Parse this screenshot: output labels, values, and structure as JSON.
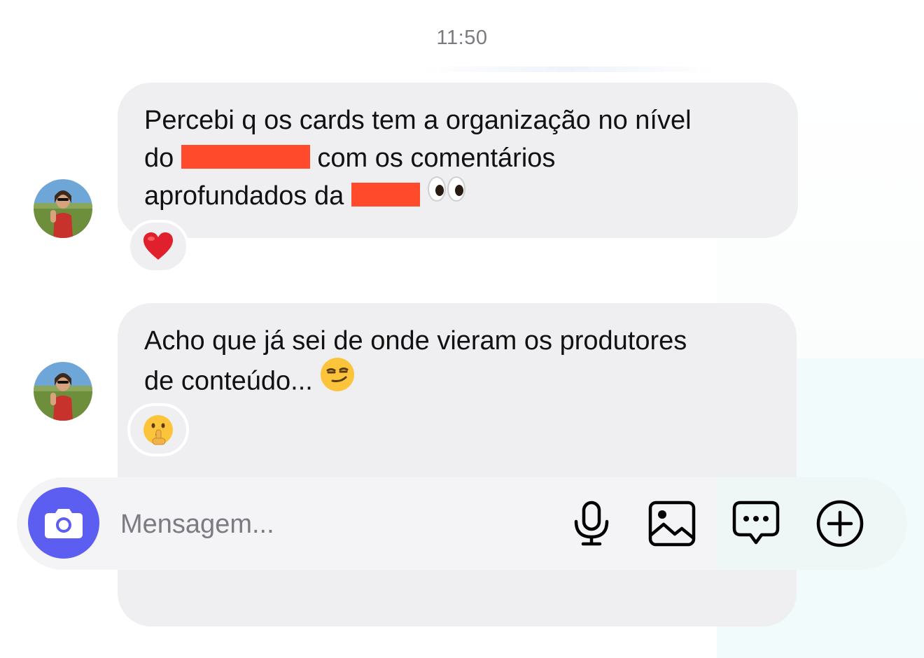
{
  "timestamp": "11:50",
  "messages": [
    {
      "line1": "Percebi q os cards tem a organização no nível",
      "line2_a": "do ",
      "line2_b": " com os comentários",
      "line3_a": "aprofundados da ",
      "line3_emoji": "eyes-emoji",
      "reaction": "heart-emoji"
    },
    {
      "line1": "Acho que já sei de onde vieram os produtores",
      "line2": "de conteúdo... ",
      "line2_emoji": "smirking-face-emoji",
      "reaction": "shushing-face-emoji"
    }
  ],
  "composer": {
    "placeholder": "Mensagem...",
    "icons": [
      "camera-icon",
      "microphone-icon",
      "image-icon",
      "chat-bubble-icon",
      "plus-circle-icon"
    ]
  },
  "colors": {
    "accent": "#5b5ef0",
    "bubble": "#efeff2",
    "redaction": "#ff4a2b",
    "timestamp": "#7a7b80"
  }
}
